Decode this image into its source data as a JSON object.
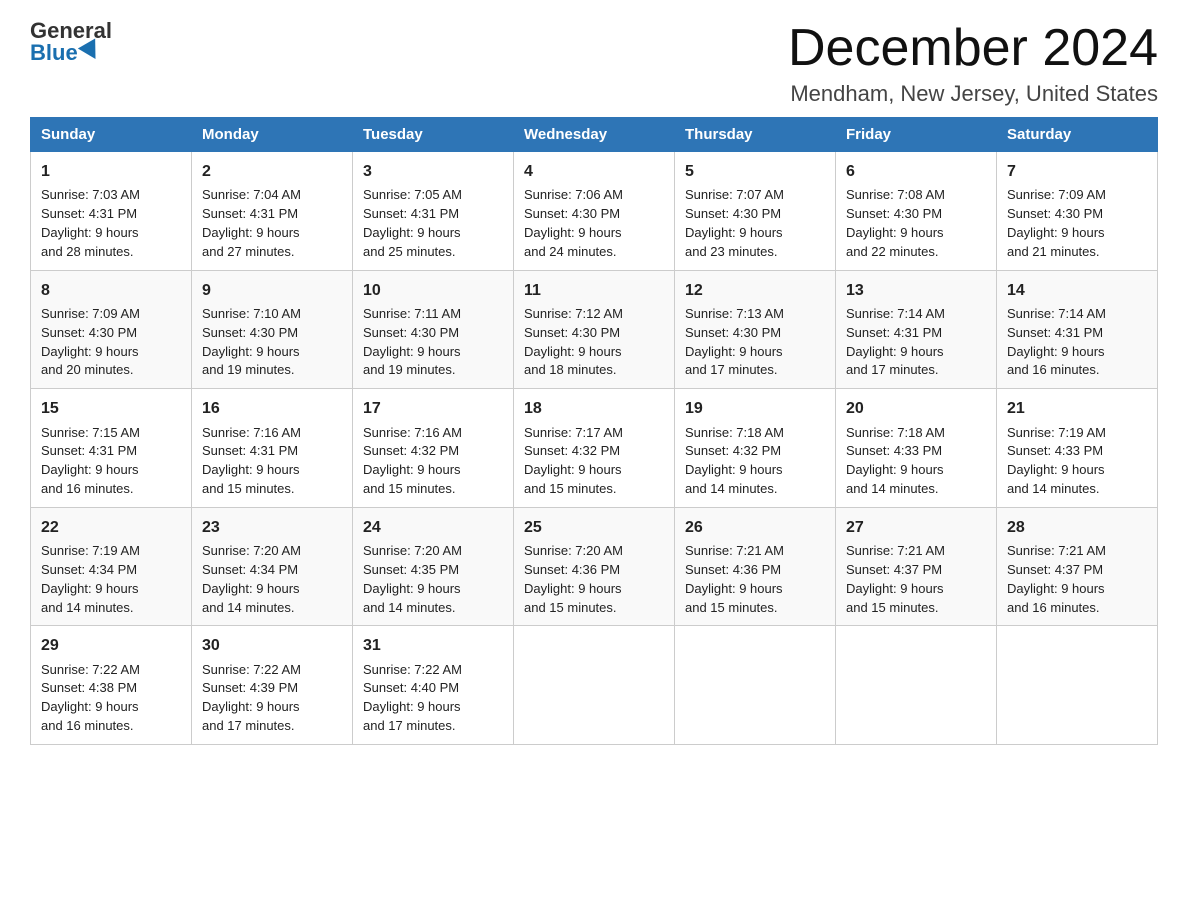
{
  "header": {
    "logo_general": "General",
    "logo_blue": "Blue",
    "month_title": "December 2024",
    "location": "Mendham, New Jersey, United States"
  },
  "weekdays": [
    "Sunday",
    "Monday",
    "Tuesday",
    "Wednesday",
    "Thursday",
    "Friday",
    "Saturday"
  ],
  "weeks": [
    [
      {
        "day": "1",
        "sunrise": "7:03 AM",
        "sunset": "4:31 PM",
        "daylight": "9 hours and 28 minutes."
      },
      {
        "day": "2",
        "sunrise": "7:04 AM",
        "sunset": "4:31 PM",
        "daylight": "9 hours and 27 minutes."
      },
      {
        "day": "3",
        "sunrise": "7:05 AM",
        "sunset": "4:31 PM",
        "daylight": "9 hours and 25 minutes."
      },
      {
        "day": "4",
        "sunrise": "7:06 AM",
        "sunset": "4:30 PM",
        "daylight": "9 hours and 24 minutes."
      },
      {
        "day": "5",
        "sunrise": "7:07 AM",
        "sunset": "4:30 PM",
        "daylight": "9 hours and 23 minutes."
      },
      {
        "day": "6",
        "sunrise": "7:08 AM",
        "sunset": "4:30 PM",
        "daylight": "9 hours and 22 minutes."
      },
      {
        "day": "7",
        "sunrise": "7:09 AM",
        "sunset": "4:30 PM",
        "daylight": "9 hours and 21 minutes."
      }
    ],
    [
      {
        "day": "8",
        "sunrise": "7:09 AM",
        "sunset": "4:30 PM",
        "daylight": "9 hours and 20 minutes."
      },
      {
        "day": "9",
        "sunrise": "7:10 AM",
        "sunset": "4:30 PM",
        "daylight": "9 hours and 19 minutes."
      },
      {
        "day": "10",
        "sunrise": "7:11 AM",
        "sunset": "4:30 PM",
        "daylight": "9 hours and 19 minutes."
      },
      {
        "day": "11",
        "sunrise": "7:12 AM",
        "sunset": "4:30 PM",
        "daylight": "9 hours and 18 minutes."
      },
      {
        "day": "12",
        "sunrise": "7:13 AM",
        "sunset": "4:30 PM",
        "daylight": "9 hours and 17 minutes."
      },
      {
        "day": "13",
        "sunrise": "7:14 AM",
        "sunset": "4:31 PM",
        "daylight": "9 hours and 17 minutes."
      },
      {
        "day": "14",
        "sunrise": "7:14 AM",
        "sunset": "4:31 PM",
        "daylight": "9 hours and 16 minutes."
      }
    ],
    [
      {
        "day": "15",
        "sunrise": "7:15 AM",
        "sunset": "4:31 PM",
        "daylight": "9 hours and 16 minutes."
      },
      {
        "day": "16",
        "sunrise": "7:16 AM",
        "sunset": "4:31 PM",
        "daylight": "9 hours and 15 minutes."
      },
      {
        "day": "17",
        "sunrise": "7:16 AM",
        "sunset": "4:32 PM",
        "daylight": "9 hours and 15 minutes."
      },
      {
        "day": "18",
        "sunrise": "7:17 AM",
        "sunset": "4:32 PM",
        "daylight": "9 hours and 15 minutes."
      },
      {
        "day": "19",
        "sunrise": "7:18 AM",
        "sunset": "4:32 PM",
        "daylight": "9 hours and 14 minutes."
      },
      {
        "day": "20",
        "sunrise": "7:18 AM",
        "sunset": "4:33 PM",
        "daylight": "9 hours and 14 minutes."
      },
      {
        "day": "21",
        "sunrise": "7:19 AM",
        "sunset": "4:33 PM",
        "daylight": "9 hours and 14 minutes."
      }
    ],
    [
      {
        "day": "22",
        "sunrise": "7:19 AM",
        "sunset": "4:34 PM",
        "daylight": "9 hours and 14 minutes."
      },
      {
        "day": "23",
        "sunrise": "7:20 AM",
        "sunset": "4:34 PM",
        "daylight": "9 hours and 14 minutes."
      },
      {
        "day": "24",
        "sunrise": "7:20 AM",
        "sunset": "4:35 PM",
        "daylight": "9 hours and 14 minutes."
      },
      {
        "day": "25",
        "sunrise": "7:20 AM",
        "sunset": "4:36 PM",
        "daylight": "9 hours and 15 minutes."
      },
      {
        "day": "26",
        "sunrise": "7:21 AM",
        "sunset": "4:36 PM",
        "daylight": "9 hours and 15 minutes."
      },
      {
        "day": "27",
        "sunrise": "7:21 AM",
        "sunset": "4:37 PM",
        "daylight": "9 hours and 15 minutes."
      },
      {
        "day": "28",
        "sunrise": "7:21 AM",
        "sunset": "4:37 PM",
        "daylight": "9 hours and 16 minutes."
      }
    ],
    [
      {
        "day": "29",
        "sunrise": "7:22 AM",
        "sunset": "4:38 PM",
        "daylight": "9 hours and 16 minutes."
      },
      {
        "day": "30",
        "sunrise": "7:22 AM",
        "sunset": "4:39 PM",
        "daylight": "9 hours and 17 minutes."
      },
      {
        "day": "31",
        "sunrise": "7:22 AM",
        "sunset": "4:40 PM",
        "daylight": "9 hours and 17 minutes."
      },
      null,
      null,
      null,
      null
    ]
  ],
  "labels": {
    "sunrise": "Sunrise:",
    "sunset": "Sunset:",
    "daylight": "Daylight:"
  }
}
